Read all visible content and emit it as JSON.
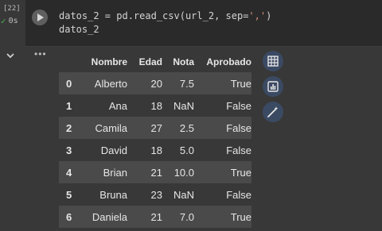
{
  "gutter": {
    "exec_count": "[22]",
    "exec_time": "0s"
  },
  "code": {
    "line1_a": "datos_2 = pd.read_csv(url_2, sep=",
    "line1_str": "','",
    "line1_b": ")",
    "line2": "datos_2"
  },
  "output": {
    "menu_label": "•••"
  },
  "table": {
    "columns": [
      "",
      "Nombre",
      "Edad",
      "Nota",
      "Aprobado"
    ],
    "rows": [
      [
        "0",
        "Alberto",
        "20",
        "7.5",
        "True"
      ],
      [
        "1",
        "Ana",
        "18",
        "NaN",
        "False"
      ],
      [
        "2",
        "Camila",
        "27",
        "2.5",
        "False"
      ],
      [
        "3",
        "David",
        "18",
        "5.0",
        "False"
      ],
      [
        "4",
        "Brian",
        "21",
        "10.0",
        "True"
      ],
      [
        "5",
        "Bruna",
        "23",
        "NaN",
        "False"
      ],
      [
        "6",
        "Daniela",
        "21",
        "7.0",
        "True"
      ]
    ]
  },
  "icons": {
    "run": "play-icon",
    "collapse": "chevron-down-icon",
    "table_view": "table-icon",
    "chart": "bar-chart-icon",
    "generate": "magic-wand-icon"
  },
  "colors": {
    "accent_button": "#3b4a63",
    "success": "#4caf50"
  }
}
